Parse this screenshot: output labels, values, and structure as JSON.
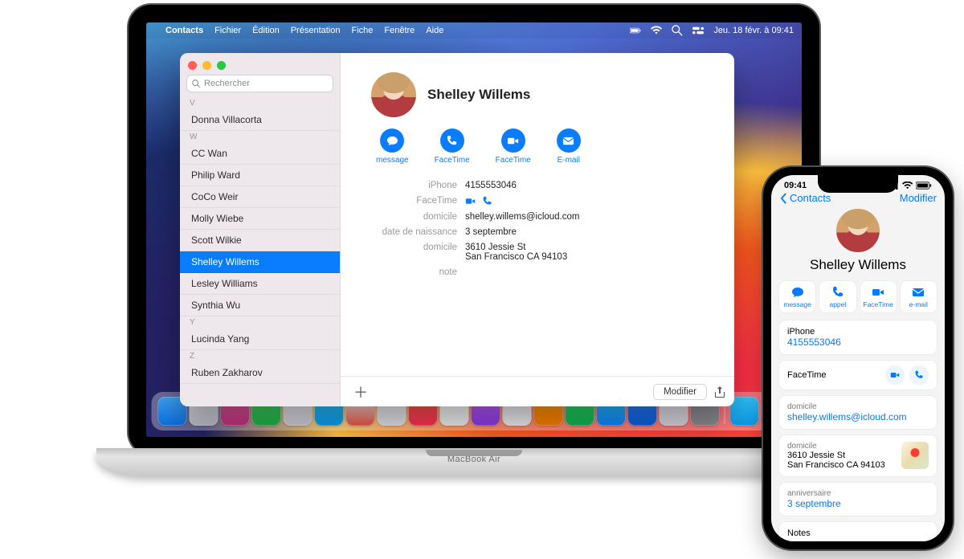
{
  "mac": {
    "menubar": {
      "app": "Contacts",
      "items": [
        "Fichier",
        "Édition",
        "Présentation",
        "Fiche",
        "Fenêtre",
        "Aide"
      ],
      "datetime": "Jeu. 18 févr. à 09:41"
    },
    "contacts_window": {
      "search_placeholder": "Rechercher",
      "letters": [
        "V",
        "W",
        "Y",
        "Z"
      ],
      "list": [
        {
          "letter": "V",
          "name": "Donna Villacorta"
        },
        {
          "letter": "W",
          "name": "CC Wan"
        },
        {
          "letter": "W",
          "name": "Philip Ward"
        },
        {
          "letter": "W",
          "name": "CoCo Weir"
        },
        {
          "letter": "W",
          "name": "Molly Wiebe"
        },
        {
          "letter": "W",
          "name": "Scott Wilkie"
        },
        {
          "letter": "W",
          "name": "Shelley Willems",
          "selected": true
        },
        {
          "letter": "W",
          "name": "Lesley Williams"
        },
        {
          "letter": "W",
          "name": "Synthia Wu"
        },
        {
          "letter": "Y",
          "name": "Lucinda Yang"
        },
        {
          "letter": "Z",
          "name": "Ruben Zakharov"
        }
      ],
      "contact": {
        "name": "Shelley Willems",
        "actions": [
          "message",
          "FaceTime",
          "FaceTime",
          "E-mail"
        ],
        "fields": [
          {
            "label": "iPhone",
            "value": "4155553046"
          },
          {
            "label": "FaceTime",
            "value": "",
            "facetime": true
          },
          {
            "label": "domicile",
            "value": "shelley.willems@icloud.com"
          },
          {
            "label": "date de naissance",
            "value": "3 septembre"
          },
          {
            "label": "domicile",
            "value": "3610 Jessie St\nSan Francisco CA 94103"
          },
          {
            "label": "note",
            "value": ""
          }
        ]
      },
      "footer": {
        "modify": "Modifier"
      }
    },
    "hinge_label": "MacBook Air"
  },
  "iphone": {
    "status_time": "09:41",
    "nav": {
      "back": "Contacts",
      "edit": "Modifier"
    },
    "name": "Shelley Willems",
    "chips": [
      "message",
      "appel",
      "FaceTime",
      "e-mail"
    ],
    "cards": {
      "phone": {
        "label": "iPhone",
        "value": "4155553046"
      },
      "facetime": {
        "label": "FaceTime"
      },
      "email": {
        "label": "domicile",
        "value": "shelley.willems@icloud.com"
      },
      "address": {
        "label": "domicile",
        "line1": "3610 Jessie St",
        "line2": "San Francisco CA 94103"
      },
      "bday": {
        "label": "anniversaire",
        "value": "3 septembre"
      },
      "notes": {
        "label": "Notes"
      }
    }
  },
  "dock_colors": [
    "linear-gradient(#3fa0f0,#0a6fe0)",
    "linear-gradient(#e0e0e6,#bcbcc5)",
    "linear-gradient(#e55ea0,#c2307d)",
    "linear-gradient(#52d769,#1bb146)",
    "linear-gradient(#e8e8ee,#cfcfd7)",
    "linear-gradient(#34c8ff,#0a9df0)",
    "linear-gradient(#fff,#f05040)",
    "linear-gradient(#f0f0f4,#e2e2e8)",
    "linear-gradient(#ff5f45,#ff2d55)",
    "linear-gradient(#fff,#ececf0)",
    "linear-gradient(#c86bff,#8b36e8)",
    "#ededf1",
    "linear-gradient(#ff9f0a,#ff7a00)",
    "linear-gradient(#2fe06b,#0fb351)",
    "linear-gradient(#30c8ff,#0a84ff)",
    "linear-gradient(#3082ff,#0a5fe0)",
    "linear-gradient(#e8e8ee,#d6d6de)",
    "#8e8e93",
    "linear-gradient(#34c8ff,#0a9df0)",
    "linear-gradient(#7a7a82,#4c4c55)"
  ]
}
